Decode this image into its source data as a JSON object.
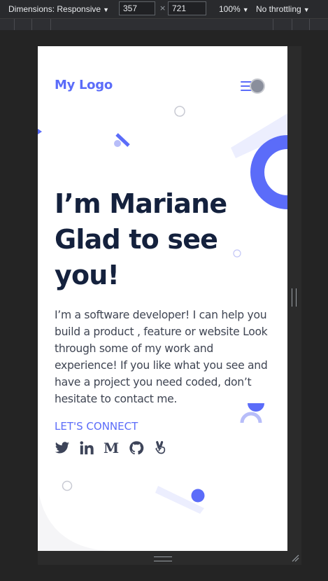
{
  "devtools": {
    "dimensions_label": "Dimensions: Responsive",
    "width_value": "357",
    "height_value": "721",
    "times_symbol": "×",
    "zoom": "100%",
    "throttling": "No throttling"
  },
  "site": {
    "logo": "My Logo",
    "headline_line1": "I’m Mariane",
    "headline_line2": "Glad to see",
    "headline_line3": "you!",
    "intro": "I’m a software developer! I can help you build a product , feature or website Look through some of my work and experience! If you like what you see and have a project you need coded, don’t hesitate to contact me.",
    "connect_label": "LET'S CONNECT",
    "social_links": [
      {
        "icon": "twitter-icon"
      },
      {
        "icon": "linkedin-icon"
      },
      {
        "icon": "medium-icon",
        "glyph": "M"
      },
      {
        "icon": "github-icon"
      },
      {
        "icon": "angellist-icon"
      }
    ]
  },
  "colors": {
    "accent": "#5b6cf9",
    "headline": "#14213d",
    "body_text": "#3f4553",
    "icon": "#3d4459",
    "decor_light": "#eceefe"
  }
}
